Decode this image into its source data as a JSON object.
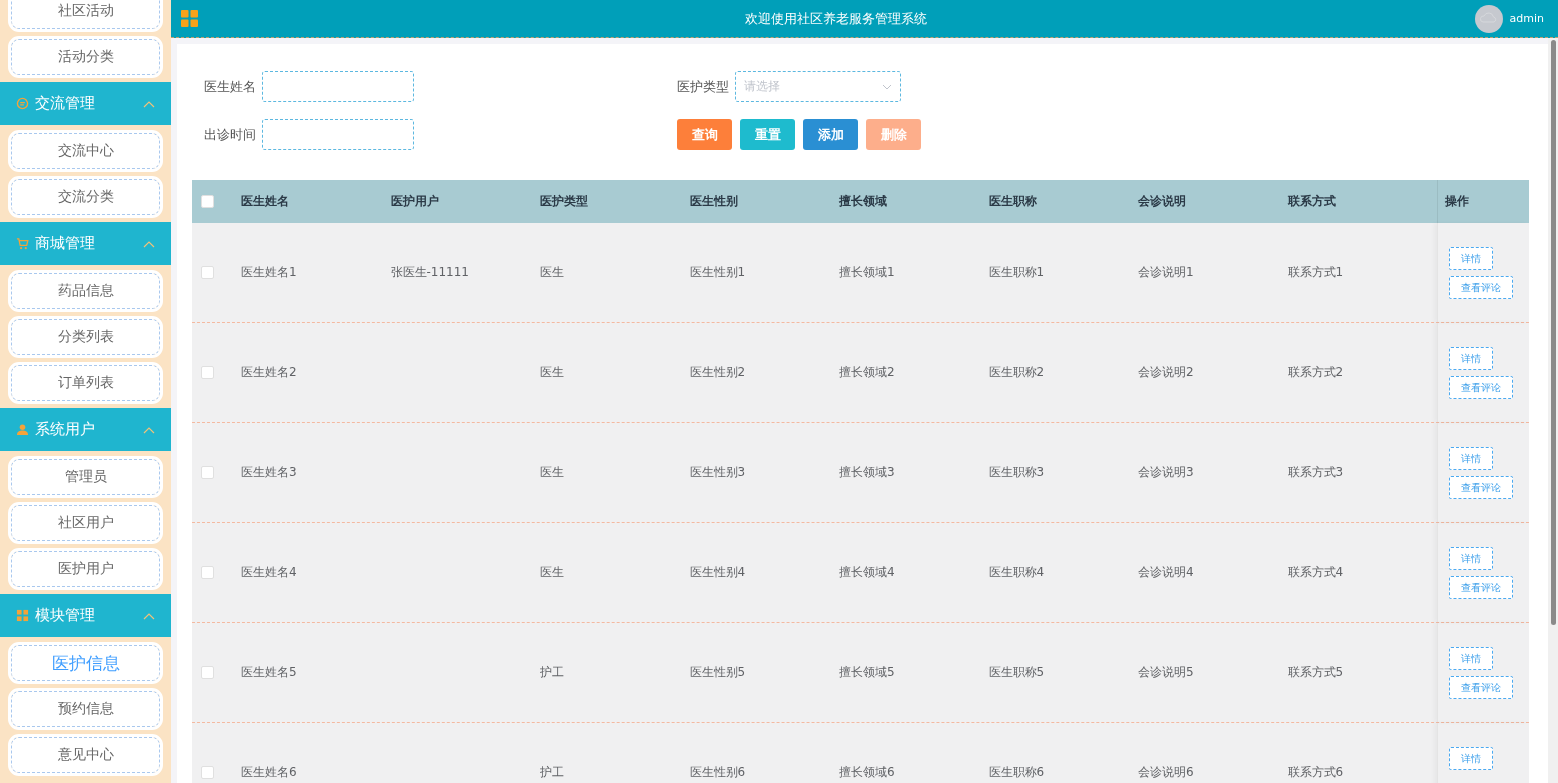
{
  "header": {
    "title": "欢迎使用社区养老服务管理系统",
    "user": "admin"
  },
  "sidebar": {
    "top_items": [
      {
        "label": "社区活动",
        "selected": false
      },
      {
        "label": "活动分类",
        "selected": false
      }
    ],
    "groups": [
      {
        "title": "交流管理",
        "expanded": true,
        "items": [
          {
            "label": "交流中心",
            "selected": false
          },
          {
            "label": "交流分类",
            "selected": false
          }
        ]
      },
      {
        "title": "商城管理",
        "expanded": true,
        "items": [
          {
            "label": "药品信息",
            "selected": false
          },
          {
            "label": "分类列表",
            "selected": false
          },
          {
            "label": "订单列表",
            "selected": false
          }
        ]
      },
      {
        "title": "系统用户",
        "expanded": true,
        "items": [
          {
            "label": "管理员",
            "selected": false
          },
          {
            "label": "社区用户",
            "selected": false
          },
          {
            "label": "医护用户",
            "selected": false
          }
        ]
      },
      {
        "title": "模块管理",
        "expanded": true,
        "items": [
          {
            "label": "医护信息",
            "selected": true
          },
          {
            "label": "预约信息",
            "selected": false
          },
          {
            "label": "意见中心",
            "selected": false
          }
        ]
      }
    ]
  },
  "search_form": {
    "fields": [
      {
        "kind": "text",
        "label": "医生姓名"
      },
      {
        "kind": "select",
        "label": "医护类型",
        "placeholder": "请选择"
      },
      {
        "kind": "text",
        "label": "出诊时间"
      }
    ],
    "buttons": [
      {
        "kind": "search",
        "label": "查询",
        "disabled": false
      },
      {
        "kind": "reset",
        "label": "重置",
        "disabled": false
      },
      {
        "kind": "add",
        "label": "添加",
        "disabled": false
      },
      {
        "kind": "delete",
        "label": "删除",
        "disabled": true
      }
    ]
  },
  "table": {
    "all_checked": false,
    "columns": [
      "医生姓名",
      "医护用户",
      "医护类型",
      "医生性别",
      "擅长领域",
      "医生职称",
      "会诊说明",
      "联系方式",
      "操作"
    ],
    "rows": [
      {
        "selected": false,
        "cells": [
          "医生姓名1",
          "张医生-11111",
          "医生",
          "医生性别1",
          "擅长领域1",
          "医生职称1",
          "会诊说明1",
          "联系方式1"
        ],
        "actions": [
          "详情",
          "查看评论"
        ]
      },
      {
        "selected": false,
        "cells": [
          "医生姓名2",
          null,
          "医生",
          "医生性别2",
          "擅长领域2",
          "医生职称2",
          "会诊说明2",
          "联系方式2"
        ],
        "actions": [
          "详情",
          "查看评论"
        ]
      },
      {
        "selected": false,
        "cells": [
          "医生姓名3",
          null,
          "医生",
          "医生性别3",
          "擅长领域3",
          "医生职称3",
          "会诊说明3",
          "联系方式3"
        ],
        "actions": [
          "详情",
          "查看评论"
        ]
      },
      {
        "selected": false,
        "cells": [
          "医生姓名4",
          null,
          "医生",
          "医生性别4",
          "擅长领域4",
          "医生职称4",
          "会诊说明4",
          "联系方式4"
        ],
        "actions": [
          "详情",
          "查看评论"
        ]
      },
      {
        "selected": false,
        "cells": [
          "医生姓名5",
          null,
          "护工",
          "医生性别5",
          "擅长领域5",
          "医生职称5",
          "会诊说明5",
          "联系方式5"
        ],
        "actions": [
          "详情",
          "查看评论"
        ]
      },
      {
        "selected": false,
        "cells": [
          "医生姓名6",
          null,
          "护工",
          "医生性别6",
          "擅长领域6",
          "医生职称6",
          "会诊说明6",
          "联系方式6"
        ],
        "actions": [
          "详情"
        ]
      }
    ]
  }
}
